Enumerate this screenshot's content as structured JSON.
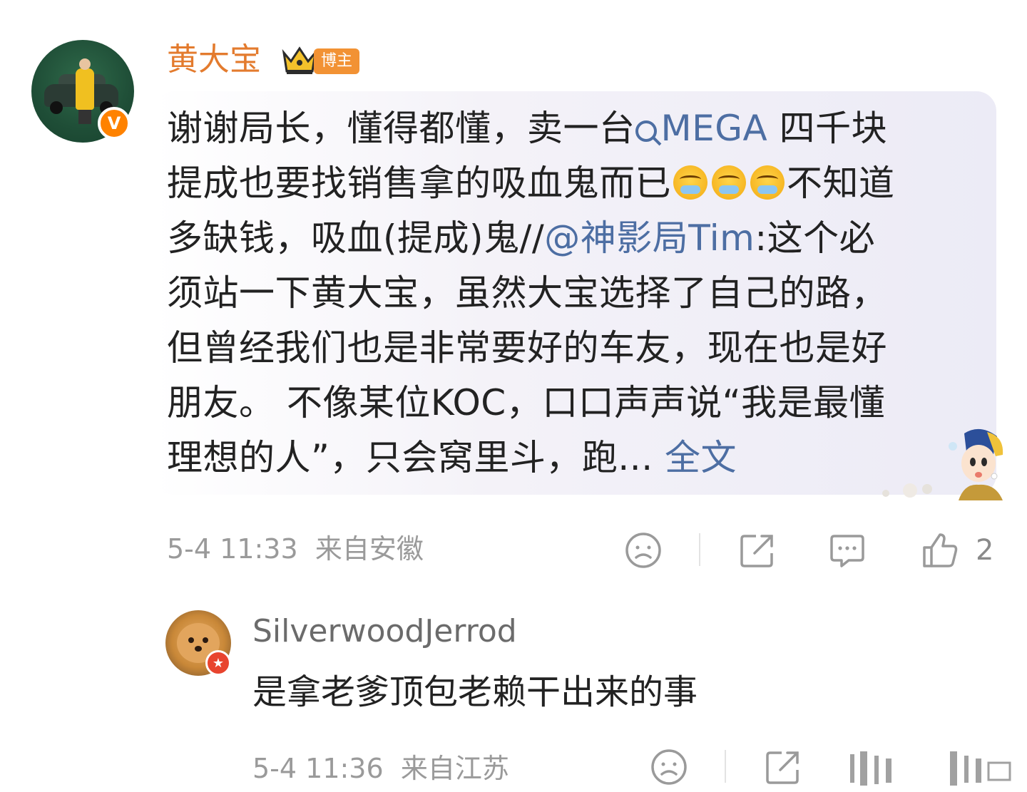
{
  "comment": {
    "username": "黄大宝",
    "badge_label": "博主",
    "verified_mark": "V",
    "line1_a": "谢谢局长，懂得都懂，卖一台",
    "line1_link": "MEGA",
    "line1_b": " 四千块",
    "line2_a": "提成也要找销售拿的吸血鬼而已",
    "line2_b": "不知道",
    "line3_a": "多缺钱，吸血(提成)鬼//",
    "line3_mention": "@神影局Tim",
    "line3_b": ":这个必",
    "line4": "须站一下黄大宝，虽然大宝选择了自己的路，",
    "line5": "但曾经我们也是非常要好的车友，现在也是好",
    "line6": "朋友。 不像某位KOC，口口声声说“我是最懂",
    "line7_a": "理想的人”，只会窝里斗，跑... ",
    "line7_more": "全文",
    "emoji_name": "crying-emoji",
    "timestamp": "5-4 11:33",
    "location": "来自安徽",
    "like_count": "2"
  },
  "reply": {
    "username": "SilverwoodJerrod",
    "text": "是拿老爹顶包老赖干出来的事",
    "timestamp": "5-4 11:36",
    "location": "来自江苏",
    "badge_icon": "star-icon"
  },
  "colors": {
    "username_orange": "#e37b2e",
    "link_blue": "#4d6ea3",
    "meta_gray": "#9a9a9a",
    "badge_orange": "#f29234"
  }
}
